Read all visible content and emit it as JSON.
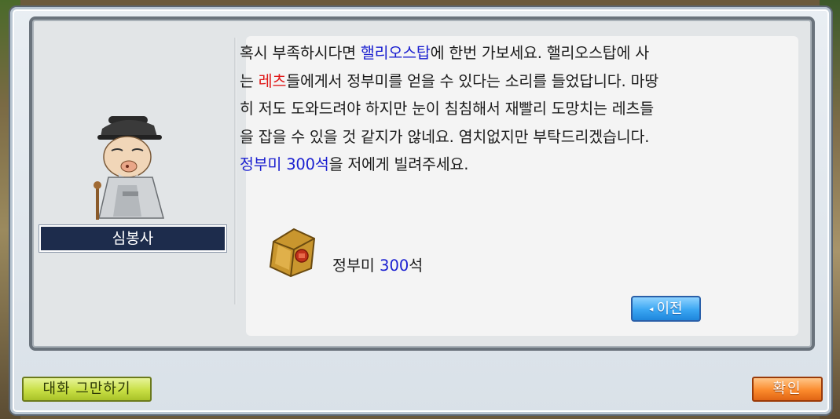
{
  "npc": {
    "name": "심봉사"
  },
  "dialog": {
    "line1_a": "혹시 부족하시다면 ",
    "line1_b": "핼리오스탑",
    "line1_c": "에 한번 가보세요. 핼리오스탑에 사",
    "line2_a": "는 ",
    "line2_b": "레츠",
    "line2_c": "들에게서 정부미를 얻을 수 있다는 소리를 들었답니다. 마땅",
    "line3": "히 저도 도와드려야 하지만 눈이 침침해서 재빨리 도망치는 레츠들",
    "line4": "을 잡을 수 있을 것 같지가 않네요. 염치없지만 부탁드리겠습니다.",
    "line5_a": "정부미 300석",
    "line5_b": "을 저에게 빌려주세요."
  },
  "reward": {
    "label_a": "정부미 ",
    "label_b": "300",
    "label_c": "석",
    "icon": "rice-sack-icon"
  },
  "buttons": {
    "prev_arrow": "◂",
    "prev": "이전",
    "end_chat": "대화 그만하기",
    "ok": "확인"
  },
  "colors": {
    "highlight_blue": "#1a1fd0",
    "highlight_red": "#e01a1a",
    "name_bg": "#1d2c4c"
  }
}
